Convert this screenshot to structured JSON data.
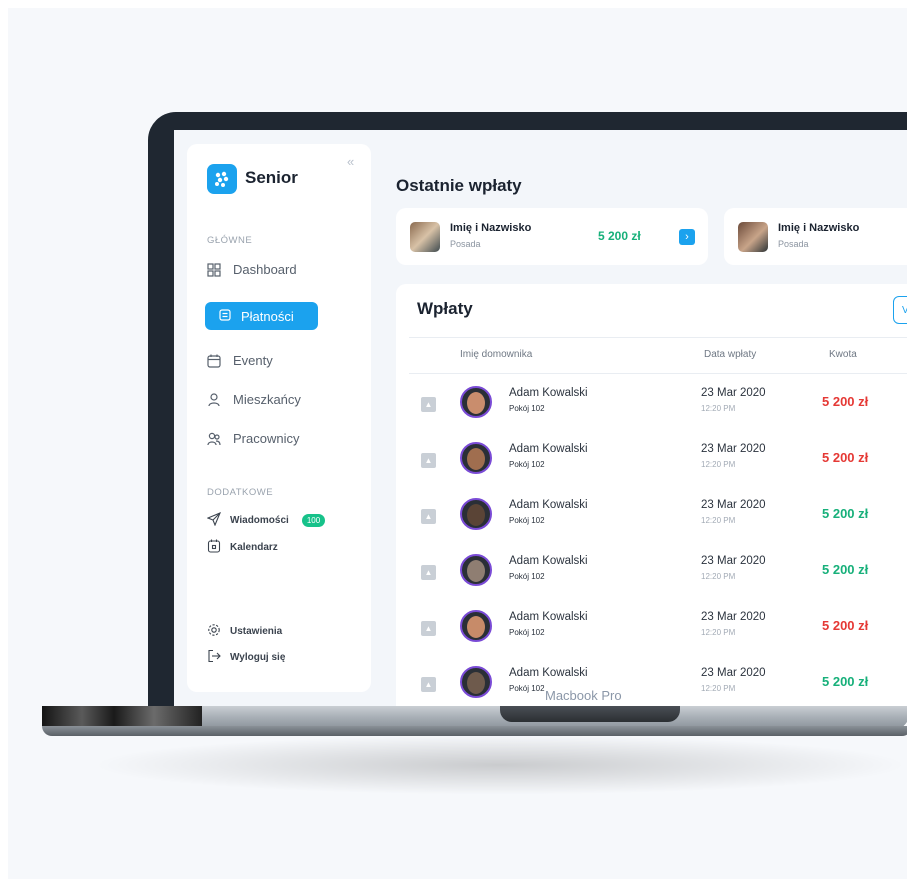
{
  "branding": {
    "mockup_label": "Macbook Pro"
  },
  "sidebar": {
    "logo_text": "Senior",
    "sections": {
      "main": "GŁÓWNE",
      "extra": "DODATKOWE"
    },
    "items": [
      {
        "label": "Dashboard",
        "icon": "grid-icon"
      },
      {
        "label": "Płatności",
        "icon": "wallet-icon",
        "active": true
      },
      {
        "label": "Eventy",
        "icon": "calendar-icon"
      },
      {
        "label": "Mieszkańcy",
        "icon": "user-icon"
      },
      {
        "label": "Pracownicy",
        "icon": "users-icon"
      }
    ],
    "extra_items": [
      {
        "label": "Wiadomości",
        "icon": "send-icon",
        "badge": "100"
      },
      {
        "label": "Kalendarz",
        "icon": "calendar-day-icon"
      }
    ],
    "bottom_items": [
      {
        "label": "Ustawienia",
        "icon": "gear-icon"
      },
      {
        "label": "Wyloguj się",
        "icon": "logout-icon"
      }
    ]
  },
  "recent": {
    "title": "Ostatnie wpłaty",
    "cards": [
      {
        "name": "Imię i Nazwisko",
        "position": "Posada",
        "amount": "5 200 zł"
      },
      {
        "name": "Imię i Nazwisko",
        "position": "Posada"
      }
    ]
  },
  "payments": {
    "title": "Wpłaty",
    "button_label": "V",
    "columns": {
      "name": "Imię domownika",
      "date": "Data wpłaty",
      "amount": "Kwota"
    },
    "rows": [
      {
        "name": "Adam Kowalski",
        "room": "Pokój 102",
        "date": "23 Mar 2020",
        "time": "12:20 PM",
        "amount": "5 200 zł",
        "status": "negative",
        "face": "#c98d6d"
      },
      {
        "name": "Adam Kowalski",
        "room": "Pokój 102",
        "date": "23 Mar 2020",
        "time": "12:20 PM",
        "amount": "5 200 zł",
        "status": "negative",
        "face": "#a06e4f"
      },
      {
        "name": "Adam Kowalski",
        "room": "Pokój 102",
        "date": "23 Mar 2020",
        "time": "12:20 PM",
        "amount": "5 200 zł",
        "status": "positive",
        "face": "#5a4436"
      },
      {
        "name": "Adam Kowalski",
        "room": "Pokój 102",
        "date": "23 Mar 2020",
        "time": "12:20 PM",
        "amount": "5 200 zł",
        "status": "positive",
        "face": "#8f7e72"
      },
      {
        "name": "Adam Kowalski",
        "room": "Pokój 102",
        "date": "23 Mar 2020",
        "time": "12:20 PM",
        "amount": "5 200 zł",
        "status": "negative",
        "face": "#c78b69"
      },
      {
        "name": "Adam Kowalski",
        "room": "Pokój 102",
        "date": "23 Mar 2020",
        "time": "12:20 PM",
        "amount": "5 200 zł",
        "status": "positive",
        "face": "#6e5a4c"
      }
    ]
  },
  "colors": {
    "accent": "#1ba2ee",
    "negative": "#e53935",
    "positive": "#17b07a",
    "badge": "#17c28a"
  }
}
